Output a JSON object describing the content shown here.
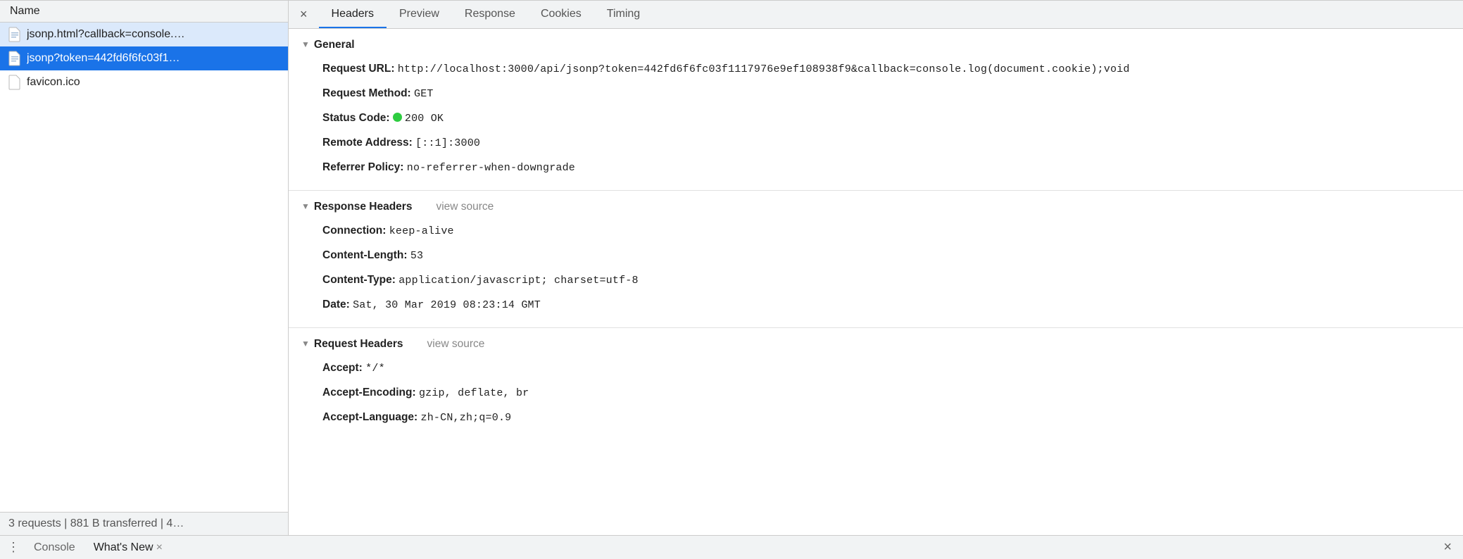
{
  "sidebar": {
    "header": "Name",
    "items": [
      {
        "label": "jsonp.html?callback=console.…",
        "icon": "file-icon",
        "state": "current"
      },
      {
        "label": "jsonp?token=442fd6f6fc03f1…",
        "icon": "file-icon",
        "state": "selected"
      },
      {
        "label": "favicon.ico",
        "icon": "empty-icon",
        "state": "none"
      }
    ],
    "footer": "3 requests | 881 B transferred | 4…"
  },
  "tabs": {
    "items": [
      "Headers",
      "Preview",
      "Response",
      "Cookies",
      "Timing"
    ],
    "activeIndex": 0
  },
  "sections": {
    "general": {
      "title": "General",
      "items": [
        {
          "k": "Request URL:",
          "v": "http://localhost:3000/api/jsonp?token=442fd6f6fc03f1117976e9ef108938f9&callback=console.log(document.cookie);void"
        },
        {
          "k": "Request Method:",
          "v": "GET"
        },
        {
          "k": "Status Code:",
          "v": "200 OK",
          "statusDot": true
        },
        {
          "k": "Remote Address:",
          "v": "[::1]:3000"
        },
        {
          "k": "Referrer Policy:",
          "v": "no-referrer-when-downgrade"
        }
      ]
    },
    "responseHeaders": {
      "title": "Response Headers",
      "viewSource": "view source",
      "items": [
        {
          "k": "Connection:",
          "v": "keep-alive"
        },
        {
          "k": "Content-Length:",
          "v": "53"
        },
        {
          "k": "Content-Type:",
          "v": "application/javascript; charset=utf-8"
        },
        {
          "k": "Date:",
          "v": "Sat, 30 Mar 2019 08:23:14 GMT"
        }
      ]
    },
    "requestHeaders": {
      "title": "Request Headers",
      "viewSource": "view source",
      "items": [
        {
          "k": "Accept:",
          "v": "*/*"
        },
        {
          "k": "Accept-Encoding:",
          "v": "gzip, deflate, br"
        },
        {
          "k": "Accept-Language:",
          "v": "zh-CN,zh;q=0.9"
        }
      ]
    }
  },
  "drawer": {
    "tabs": [
      {
        "label": "Console",
        "closable": false,
        "active": false
      },
      {
        "label": "What's New",
        "closable": true,
        "active": true
      }
    ]
  }
}
